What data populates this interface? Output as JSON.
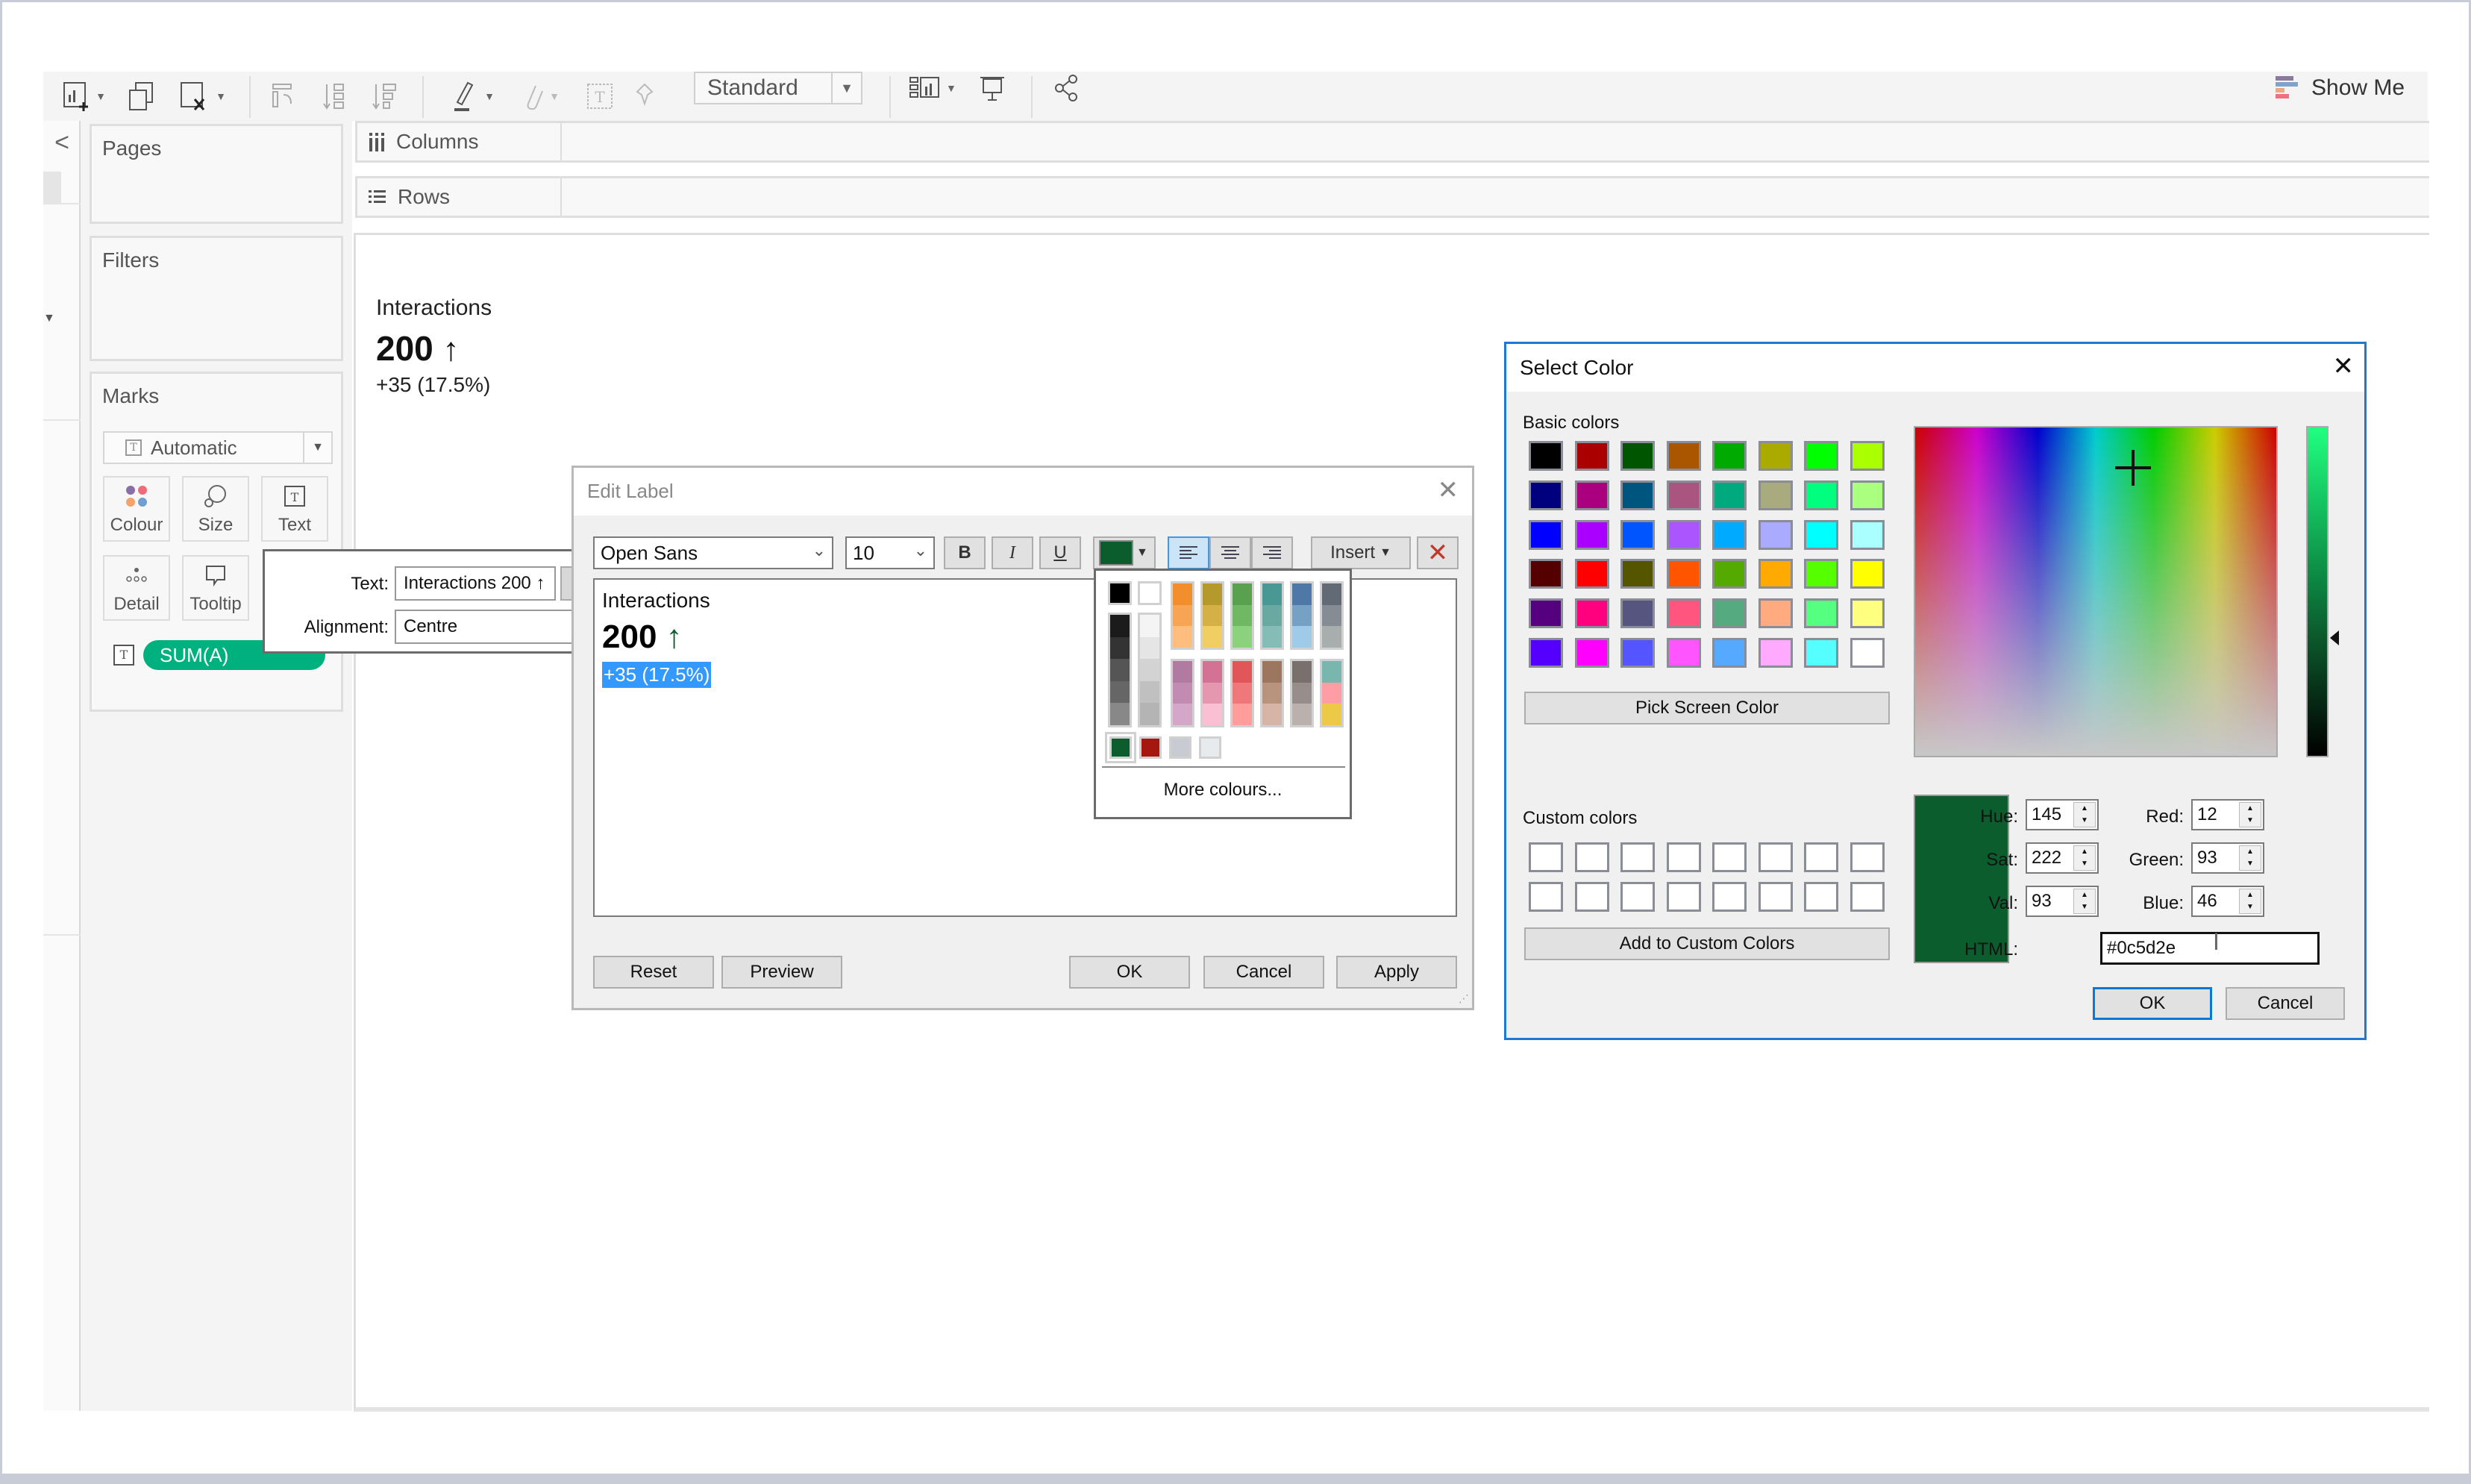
{
  "toolbar": {
    "mark_type_select": "Standard",
    "show_me": "Show Me"
  },
  "left_rail": {
    "collapse": "<"
  },
  "panels": {
    "pages": "Pages",
    "filters": "Filters",
    "marks": "Marks",
    "marks_type": "Automatic",
    "mark_buttons": [
      "Colour",
      "Size",
      "Text",
      "Detail",
      "Tooltip"
    ],
    "pill": "SUM(A)"
  },
  "shelves": {
    "columns": "Columns",
    "rows": "Rows"
  },
  "view": {
    "title": "Interactions",
    "value": "200",
    "arrow": "↑",
    "change": "+35 (17.5%)"
  },
  "text_popup": {
    "text_label": "Text:",
    "text_value": "Interactions 200 ↑",
    "alignment_label": "Alignment:",
    "alignment_value": "Centre"
  },
  "edit_label": {
    "title": "Edit Label",
    "font": "Open Sans",
    "size": "10",
    "bold": "B",
    "italic": "I",
    "underline": "U",
    "current_color": "#0c5d2e",
    "insert": "Insert",
    "content": {
      "line1": "Interactions",
      "line2_value": "200",
      "line2_arrow": "↑",
      "line3_selected": "+35 (17.5%)"
    },
    "buttons": {
      "reset": "Reset",
      "preview": "Preview",
      "ok": "OK",
      "cancel": "Cancel",
      "apply": "Apply"
    }
  },
  "color_popup": {
    "top_row": [
      "#000000",
      "#ffffff"
    ],
    "grays_dark": [
      "#1b1b1b",
      "#333333",
      "#555555",
      "#666666",
      "#888888"
    ],
    "grays_light": [
      "#f4f4f4",
      "#e5e5e5",
      "#d3d3d3",
      "#c0c0c0",
      "#b4b4b4"
    ],
    "palette_top": [
      [
        "#f28e2b",
        "#f7a554",
        "#ffbe7d"
      ],
      [
        "#b6992d",
        "#d4b046",
        "#f1ce63"
      ],
      [
        "#59a14f",
        "#71b865",
        "#8cd17d"
      ],
      [
        "#499894",
        "#6aa9a1",
        "#86bcb6"
      ],
      [
        "#4e79a7",
        "#76a1c5",
        "#a0cbe8"
      ],
      [
        "#616a75",
        "#858c94",
        "#a8adad"
      ]
    ],
    "palette_bottom": [
      [
        "#b07aa1",
        "#c28bb1",
        "#d4a6c8"
      ],
      [
        "#d37295",
        "#e697b0",
        "#fabfd2"
      ],
      [
        "#e15759",
        "#ef787a",
        "#ff9d9a"
      ],
      [
        "#9d7660",
        "#b8937d",
        "#d7b5a6"
      ],
      [
        "#79706e",
        "#978d8a",
        "#bab0ac"
      ],
      [
        "#79b6ae",
        "#ff9da7",
        "#edc948"
      ]
    ],
    "recent": [
      "#0c5d2e",
      "#a5170f",
      "#c8ccd2",
      "#e8ebee"
    ],
    "more_colours": "More colours..."
  },
  "select_color": {
    "title": "Select Color",
    "basic_colors_label": "Basic colors",
    "basic_colors": [
      "#000000",
      "#aa0000",
      "#005500",
      "#aa5500",
      "#00aa00",
      "#aaaa00",
      "#00ff00",
      "#aaff00",
      "#00007f",
      "#aa007f",
      "#00557f",
      "#aa557f",
      "#00aa7f",
      "#aaaa7f",
      "#00ff7f",
      "#aaff7f",
      "#0000ff",
      "#aa00ff",
      "#0055ff",
      "#aa55ff",
      "#00aaff",
      "#aaaaff",
      "#00ffff",
      "#aaffff",
      "#550000",
      "#ff0000",
      "#555500",
      "#ff5500",
      "#55aa00",
      "#ffaa00",
      "#55ff00",
      "#ffff00",
      "#55007f",
      "#ff007f",
      "#55557f",
      "#ff557f",
      "#55aa7f",
      "#ffaa7f",
      "#55ff7f",
      "#ffff7f",
      "#5500ff",
      "#ff00ff",
      "#5555ff",
      "#ff55ff",
      "#55aaff",
      "#ffaaff",
      "#55ffff",
      "#ffffff"
    ],
    "pick_screen_color": "Pick Screen Color",
    "custom_colors_label": "Custom colors",
    "custom_colors_count": 16,
    "add_custom": "Add to Custom Colors",
    "preview_color": "#0c5d2e",
    "fields": {
      "hue_label": "Hue:",
      "hue": "145",
      "sat_label": "Sat:",
      "sat": "222",
      "val_label": "Val:",
      "val": "93",
      "red_label": "Red:",
      "red": "12",
      "green_label": "Green:",
      "green": "93",
      "blue_label": "Blue:",
      "blue": "46",
      "html_label": "HTML:",
      "html": "#0c5d2e"
    },
    "value_slider_level": 0.36,
    "ok": "OK",
    "cancel": "Cancel"
  }
}
